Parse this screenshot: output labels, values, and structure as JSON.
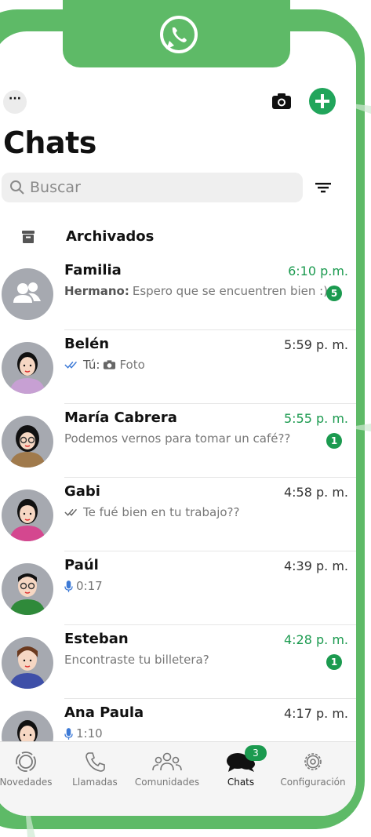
{
  "header": {
    "more_label": "···",
    "title": "Chats",
    "search_placeholder": "Buscar",
    "archived_label": "Archivados"
  },
  "chats": [
    {
      "name": "Familia",
      "time": "6:10 p.m.",
      "sender": "Hermano:",
      "message": "Espero que se encuentren bien :)",
      "badge": "5",
      "avatar": "group-icon",
      "time_highlight": true
    },
    {
      "name": "Belén",
      "time": "5:59 p. m.",
      "sender": "Tú:",
      "message": "Foto",
      "badge": "",
      "avatar": "woman-avatar",
      "time_highlight": false
    },
    {
      "name": "María Cabrera",
      "time": "5:55 p. m.",
      "sender": "",
      "message": "Podemos vernos para tomar un café??",
      "badge": "1",
      "avatar": "woman-glasses-avatar",
      "time_highlight": true
    },
    {
      "name": "Gabi",
      "time": "4:58 p. m.",
      "sender": "",
      "message": "Te fué bien en tu trabajo??",
      "badge": "",
      "avatar": "woman-avatar-pink",
      "time_highlight": false
    },
    {
      "name": "Paúl",
      "time": "4:39 p. m.",
      "sender": "",
      "message": "0:17",
      "badge": "",
      "avatar": "man-glasses-avatar",
      "time_highlight": false
    },
    {
      "name": "Esteban",
      "time": "4:28 p. m.",
      "sender": "",
      "message": "Encontraste tu billetera?",
      "badge": "1",
      "avatar": "man-avatar",
      "time_highlight": true
    },
    {
      "name": "Ana Paula",
      "time": "4:17 p. m.",
      "sender": "",
      "message": "1:10",
      "badge": "",
      "avatar": "woman-avatar-yellow",
      "time_highlight": false
    }
  ],
  "tabs": [
    {
      "label": "Novedades",
      "icon": "status-icon"
    },
    {
      "label": "Llamadas",
      "icon": "phone-icon"
    },
    {
      "label": "Comunidades",
      "icon": "communities-icon"
    },
    {
      "label": "Chats",
      "icon": "chats-icon",
      "badge": "3"
    },
    {
      "label": "Configuración",
      "icon": "gear-icon"
    }
  ],
  "colors": {
    "brand": "#5eba67",
    "accent": "#1b9a4f",
    "read_check": "#3d7ad6"
  }
}
